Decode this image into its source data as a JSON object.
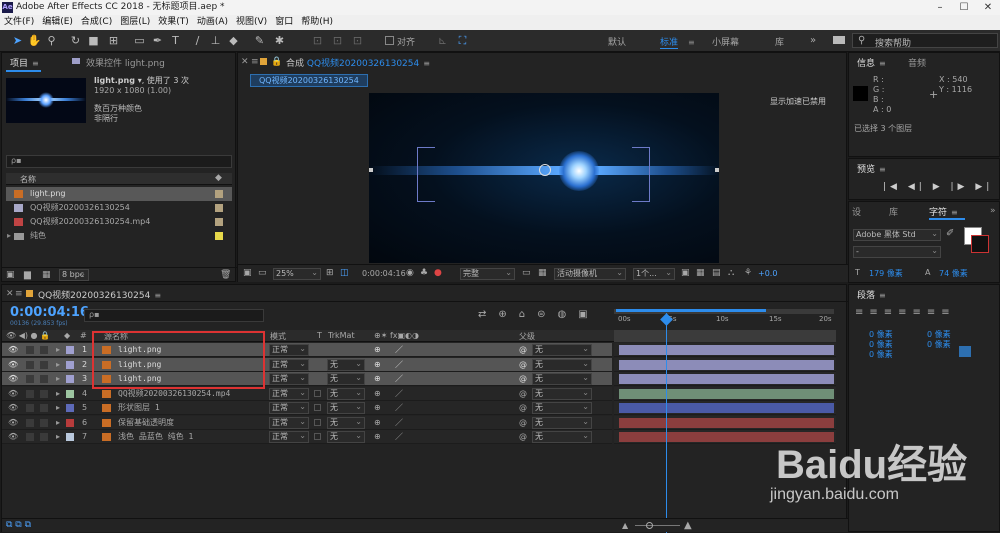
{
  "app": {
    "title": "Adobe After Effects CC 2018 - 无标题项目.aep *",
    "window_controls": [
      "–",
      "☐",
      "✕"
    ]
  },
  "menu": [
    "文件(F)",
    "编辑(E)",
    "合成(C)",
    "图层(L)",
    "效果(T)",
    "动画(A)",
    "视图(V)",
    "窗口",
    "帮助(H)"
  ],
  "toolbar": {
    "snap_label": "对齐",
    "workspaces": [
      "默认",
      "标准",
      "小屏幕",
      "库"
    ],
    "active_workspace": "标准",
    "search_help_placeholder": "搜索帮助"
  },
  "project": {
    "tab": "项目",
    "effects_tab": "效果控件 light.png",
    "item_name": "light.png ▾",
    "item_used": ", 使用了 3 次",
    "item_size": "1920 x 1080 (1.00)",
    "item_colors": "数百万种颜色",
    "item_interlace": "非隔行",
    "search_placeholder": "ρ▪",
    "col_name": "名称",
    "items": [
      {
        "name": "light.png",
        "color": "#b3a27f",
        "selected": true
      },
      {
        "name": "QQ视频20200326130254",
        "color": "#b3a27f"
      },
      {
        "name": "QQ视频20200326130254.mp4",
        "color": "#b3a27f"
      },
      {
        "name": "纯色",
        "color": "#e6d84a",
        "folder": true
      }
    ],
    "bpc": "8 bpc"
  },
  "comp": {
    "tab": "合成",
    "comp_name": "QQ视频20200326130254",
    "subtab": "QQ视频20200326130254",
    "accel_note": "显示加速已禁用",
    "zoom": "25%",
    "time": "0:00:04:16",
    "quality": "完整",
    "camera": "活动摄像机",
    "views": "1个...",
    "exposure": "+0.0"
  },
  "info": {
    "tab": "信息",
    "audio_tab": "音频",
    "r": "R :",
    "g": "G :",
    "b": "B :",
    "a": "A : 0",
    "x": "X : 540",
    "y": "Y : 1116",
    "selected": "已选择 3 个图层"
  },
  "preview": {
    "tab": "预览",
    "controls": [
      "|◀",
      "◀|",
      "▶",
      "|▶",
      "▶|"
    ]
  },
  "character": {
    "tabs": [
      "设",
      "库",
      "字符"
    ],
    "font": "Adobe 黑体 Std",
    "style": "-",
    "size": "179 像素",
    "leading": "74 像素"
  },
  "paragraph": {
    "tab": "段落",
    "values": [
      "0 像素",
      "0 像素",
      "0 像素",
      "0 像素",
      "0 像素"
    ]
  },
  "timeline": {
    "tab": "QQ视频20200326130254",
    "timecode": "0:00:04:16",
    "frames": "00136 (29.853 fps)",
    "search_placeholder": "ρ▪",
    "cols": {
      "source": "源名称",
      "mode": "模式",
      "t": "T",
      "trkmat": "TrkMat",
      "parent": "父级"
    },
    "ruler": [
      "00s",
      "05s",
      "10s",
      "15s",
      "20s"
    ],
    "layers": [
      {
        "num": "1",
        "name": "light.png",
        "mode": "正常",
        "trkmat": "",
        "parent": "无",
        "color": "#a0a0d0",
        "selected": true,
        "bar": "#8c8cb8"
      },
      {
        "num": "2",
        "name": "light.png",
        "mode": "正常",
        "trkmat": "无",
        "parent": "无",
        "color": "#a0a0d0",
        "selected": true,
        "bar": "#8c8cb8"
      },
      {
        "num": "3",
        "name": "light.png",
        "mode": "正常",
        "trkmat": "无",
        "parent": "无",
        "color": "#a0a0d0",
        "selected": true,
        "bar": "#8c8cb8"
      },
      {
        "num": "4",
        "name": "QQ视频20200326130254.mp4",
        "mode": "正常",
        "trkmat": "无",
        "parent": "无",
        "color": "#9cc4a0",
        "selected": false,
        "bar": "#6f8f77"
      },
      {
        "num": "5",
        "name": "形状图层 1",
        "mode": "正常",
        "trkmat": "无",
        "parent": "无",
        "color": "#5d6ab8",
        "selected": false,
        "bar": "#4a5aa6"
      },
      {
        "num": "6",
        "name": "保留基础透明度",
        "mode": "正常",
        "trkmat": "无",
        "parent": "无",
        "color": "#b73b3b",
        "selected": false,
        "bar": "#8b3e3e"
      },
      {
        "num": "7",
        "name": "浅色 品蓝色 纯色 1",
        "mode": "正常",
        "trkmat": "无",
        "parent": "无",
        "color": "#b9c8dc",
        "selected": false,
        "bar": "#8b3e3e"
      }
    ]
  },
  "watermark": {
    "text": "Baidu经验",
    "url": "jingyan.baidu.com"
  }
}
